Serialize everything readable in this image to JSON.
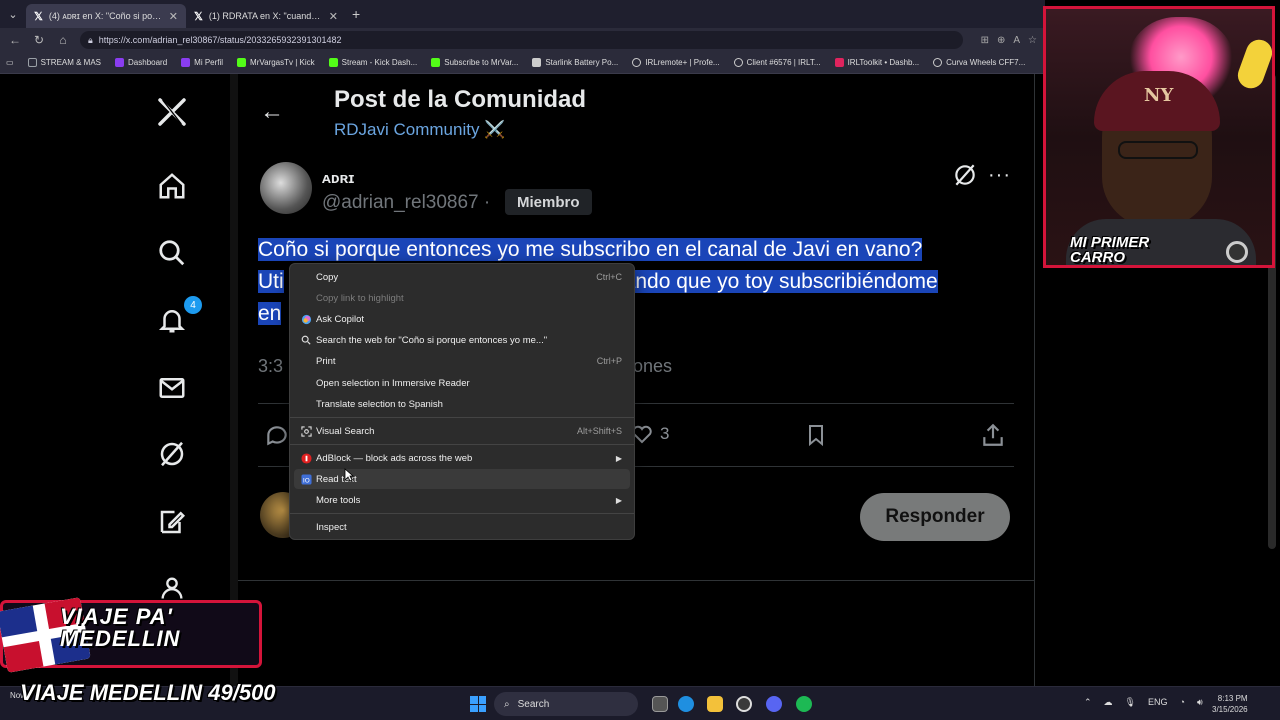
{
  "browser": {
    "tabs": [
      {
        "title": "(4) ᴀᴅʀɪ en X: \"Coño si porque ent...",
        "active": true
      },
      {
        "title": "(1) RDRATA en X: \"cuando están h...",
        "active": false
      }
    ],
    "new_tab": "+",
    "url": "https://x.com/adrian_rel30867/status/2033265932391301482",
    "bookmarks": [
      {
        "label": "STREAM & MAS",
        "color": "#9aa0a6"
      },
      {
        "label": "Dashboard",
        "color": "#8a3df0"
      },
      {
        "label": "Mi Perfil",
        "color": "#8a3df0"
      },
      {
        "label": "MrVargasTv | Kick",
        "color": "#53fc18"
      },
      {
        "label": "Stream - Kick Dash...",
        "color": "#53fc18"
      },
      {
        "label": "Subscribe to MrVar...",
        "color": "#53fc18"
      },
      {
        "label": "Starlink Battery Po...",
        "color": "#cccccc"
      },
      {
        "label": "IRLremote+ | Profe...",
        "color": "#cccccc"
      },
      {
        "label": "Client #6576 | IRLT...",
        "color": "#cccccc"
      },
      {
        "label": "IRLToolkit • Dashb...",
        "color": "#e0245e"
      },
      {
        "label": "Curva Wheels CFF7...",
        "color": "#cccccc"
      }
    ]
  },
  "nav": {
    "notifications_count": "4"
  },
  "post": {
    "back": "←",
    "page_title": "Post de la Comunidad",
    "community": "RDJavi Community ⚔️",
    "author_name": "ᴀᴅʀɪ",
    "author_handle": "@adrian_rel30867 ·",
    "member_badge": "Miembro",
    "more": "···",
    "text_line1": "Coño si porque entonces yo me subscribo en el canal de Javi en vano?",
    "text_line2_start": "Uti",
    "text_line2_end": "ando que yo toy subscribiéndome",
    "text_line3": "en",
    "time_start": "3:3",
    "time_end": "ones",
    "likes_count": "3",
    "reply_button": "Responder"
  },
  "context_menu": {
    "copy": "Copy",
    "copy_shortcut": "Ctrl+C",
    "copy_link": "Copy link to highlight",
    "ask_copilot": "Ask Copilot",
    "search_web": "Search the web for \"Coño si porque entonces yo me...\"",
    "print": "Print",
    "print_shortcut": "Ctrl+P",
    "immersive": "Open selection in Immersive Reader",
    "translate": "Translate selection to Spanish",
    "visual_search": "Visual Search",
    "visual_search_shortcut": "Alt+Shift+S",
    "adblock": "AdBlock — block ads across the web",
    "read_text": "Read text",
    "more_tools": "More tools",
    "inspect": "Inspect"
  },
  "overlay": {
    "cam_caption_1": "MI PRIMER",
    "cam_caption_2": "CARRO",
    "cap_logo": "NY",
    "promo_title_1": "VIAJE PA'",
    "promo_title_2": "MEDELLIN",
    "promo_progress": "VIAJE MEDELLIN 49/500"
  },
  "taskbar": {
    "weather": "Now",
    "search": "Search",
    "lang": "ENG",
    "time": "8:13 PM",
    "date": "3/15/2026"
  },
  "colors": {
    "accent": "#1d9bf0",
    "selection": "#1a45b8",
    "brand_red": "#d4143a"
  }
}
